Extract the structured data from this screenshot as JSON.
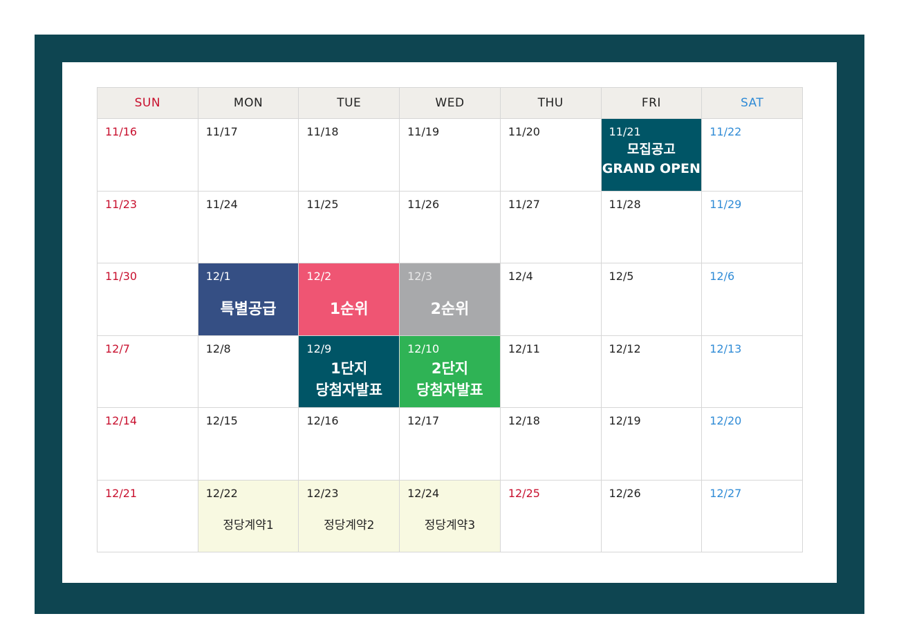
{
  "weekdays": [
    "SUN",
    "MON",
    "TUE",
    "WED",
    "THU",
    "FRI",
    "SAT"
  ],
  "colors": {
    "frame": "#0e4551",
    "sunday": "#c8102e",
    "saturday": "#2f8bd6",
    "grand_open": "#005566",
    "special_supply": "#354f84",
    "first_rank": "#ef5573",
    "second_rank": "#a8a9ab",
    "winner_complex1": "#005566",
    "winner_complex2": "#2fb355",
    "contract": "#f8f9e1"
  },
  "weeks": [
    [
      {
        "date": "11/16"
      },
      {
        "date": "11/17"
      },
      {
        "date": "11/18"
      },
      {
        "date": "11/19"
      },
      {
        "date": "11/20"
      },
      {
        "date": "11/21",
        "event_lines": [
          "모집공고",
          "GRAND OPEN"
        ]
      },
      {
        "date": "11/22"
      }
    ],
    [
      {
        "date": "11/23"
      },
      {
        "date": "11/24"
      },
      {
        "date": "11/25"
      },
      {
        "date": "11/26"
      },
      {
        "date": "11/27"
      },
      {
        "date": "11/28"
      },
      {
        "date": "11/29"
      }
    ],
    [
      {
        "date": "11/30"
      },
      {
        "date": "12/1",
        "event": "특별공급"
      },
      {
        "date": "12/2",
        "event": "1순위"
      },
      {
        "date": "12/3",
        "event": "2순위"
      },
      {
        "date": "12/4"
      },
      {
        "date": "12/5"
      },
      {
        "date": "12/6"
      }
    ],
    [
      {
        "date": "12/7"
      },
      {
        "date": "12/8"
      },
      {
        "date": "12/9",
        "event_lines": [
          "1단지",
          "당첨자발표"
        ]
      },
      {
        "date": "12/10",
        "event_lines": [
          "2단지",
          "당첨자발표"
        ]
      },
      {
        "date": "12/11"
      },
      {
        "date": "12/12"
      },
      {
        "date": "12/13"
      }
    ],
    [
      {
        "date": "12/14"
      },
      {
        "date": "12/15"
      },
      {
        "date": "12/16"
      },
      {
        "date": "12/17"
      },
      {
        "date": "12/18"
      },
      {
        "date": "12/19"
      },
      {
        "date": "12/20"
      }
    ],
    [
      {
        "date": "12/21"
      },
      {
        "date": "12/22",
        "event": "정당계약1"
      },
      {
        "date": "12/23",
        "event": "정당계약2"
      },
      {
        "date": "12/24",
        "event": "정당계약3"
      },
      {
        "date": "12/25"
      },
      {
        "date": "12/26"
      },
      {
        "date": "12/27"
      }
    ]
  ]
}
